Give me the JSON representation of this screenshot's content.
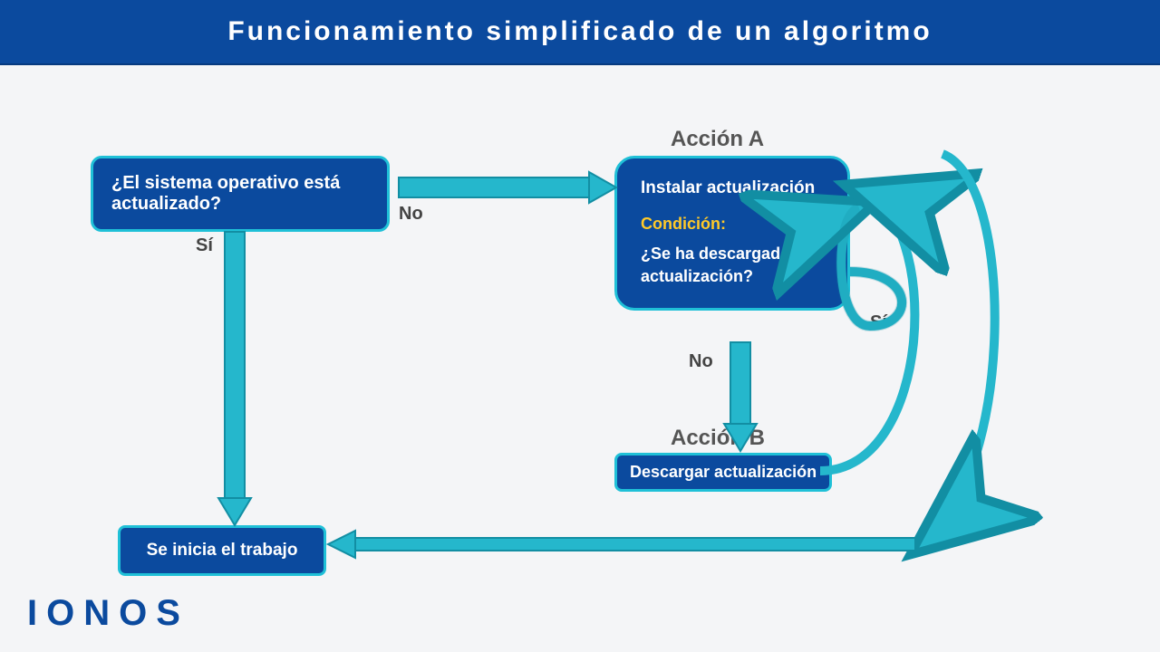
{
  "header": {
    "title": "Funcionamiento simplificado de un algoritmo"
  },
  "nodes": {
    "q_os": "¿El sistema operativo está actualizado?",
    "action_a_title": "Acción A",
    "action_a_line1": "Instalar actualización",
    "action_a_cond_label": "Condición:",
    "action_a_cond_q": "¿Se ha descargado la actualización?",
    "action_b_title": "Acción B",
    "action_b": "Descargar actualización",
    "start_work": "Se inicia el trabajo"
  },
  "edges": {
    "yes": "Sí",
    "no": "No",
    "yes2": "Sí",
    "no2": "No"
  },
  "logo": "IONOS",
  "colors": {
    "arrow": "#25b7cc",
    "arrow_stroke": "#128ea3"
  }
}
